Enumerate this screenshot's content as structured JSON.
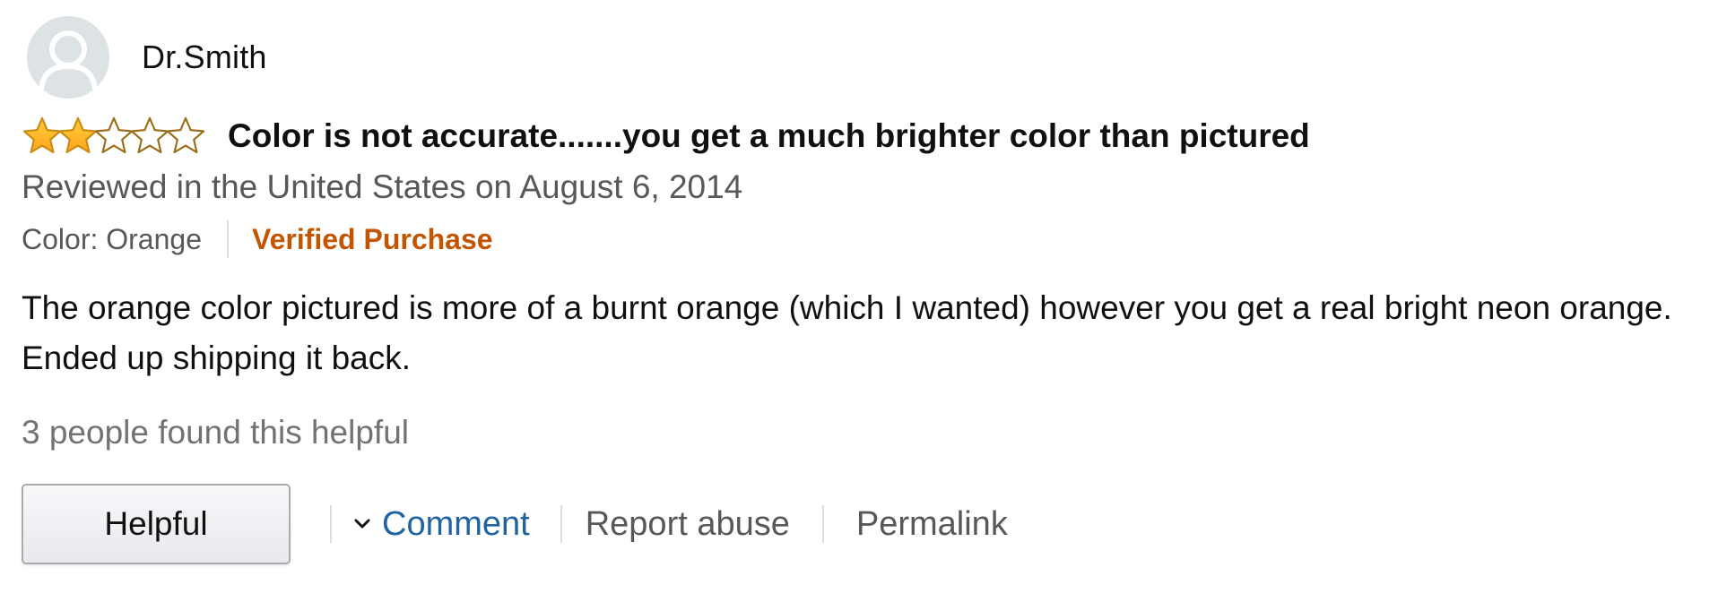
{
  "profile": {
    "name": "Dr.Smith",
    "avatar_icon": "default-avatar-icon"
  },
  "rating": {
    "value": 2,
    "max": 5,
    "filled_color": "#ffa41c",
    "filled_icon": "star-filled-icon",
    "empty_icon": "star-empty-icon"
  },
  "review": {
    "title": "Color is not accurate.......you get a much brighter color than pictured",
    "date": "Reviewed in the United States on August 6, 2014",
    "variant": "Color: Orange",
    "verified": "Verified Purchase",
    "body": "The orange color pictured is more of a burnt orange (which I wanted) however you get a real bright neon orange. Ended up shipping it back.",
    "helpful_count": "3 people found this helpful"
  },
  "actions": {
    "helpful": "Helpful",
    "comment": "Comment",
    "report": "Report abuse",
    "permalink": "Permalink"
  },
  "colors": {
    "verified": "#c45500",
    "link": "#2162a1",
    "secondary_text": "#565959"
  }
}
